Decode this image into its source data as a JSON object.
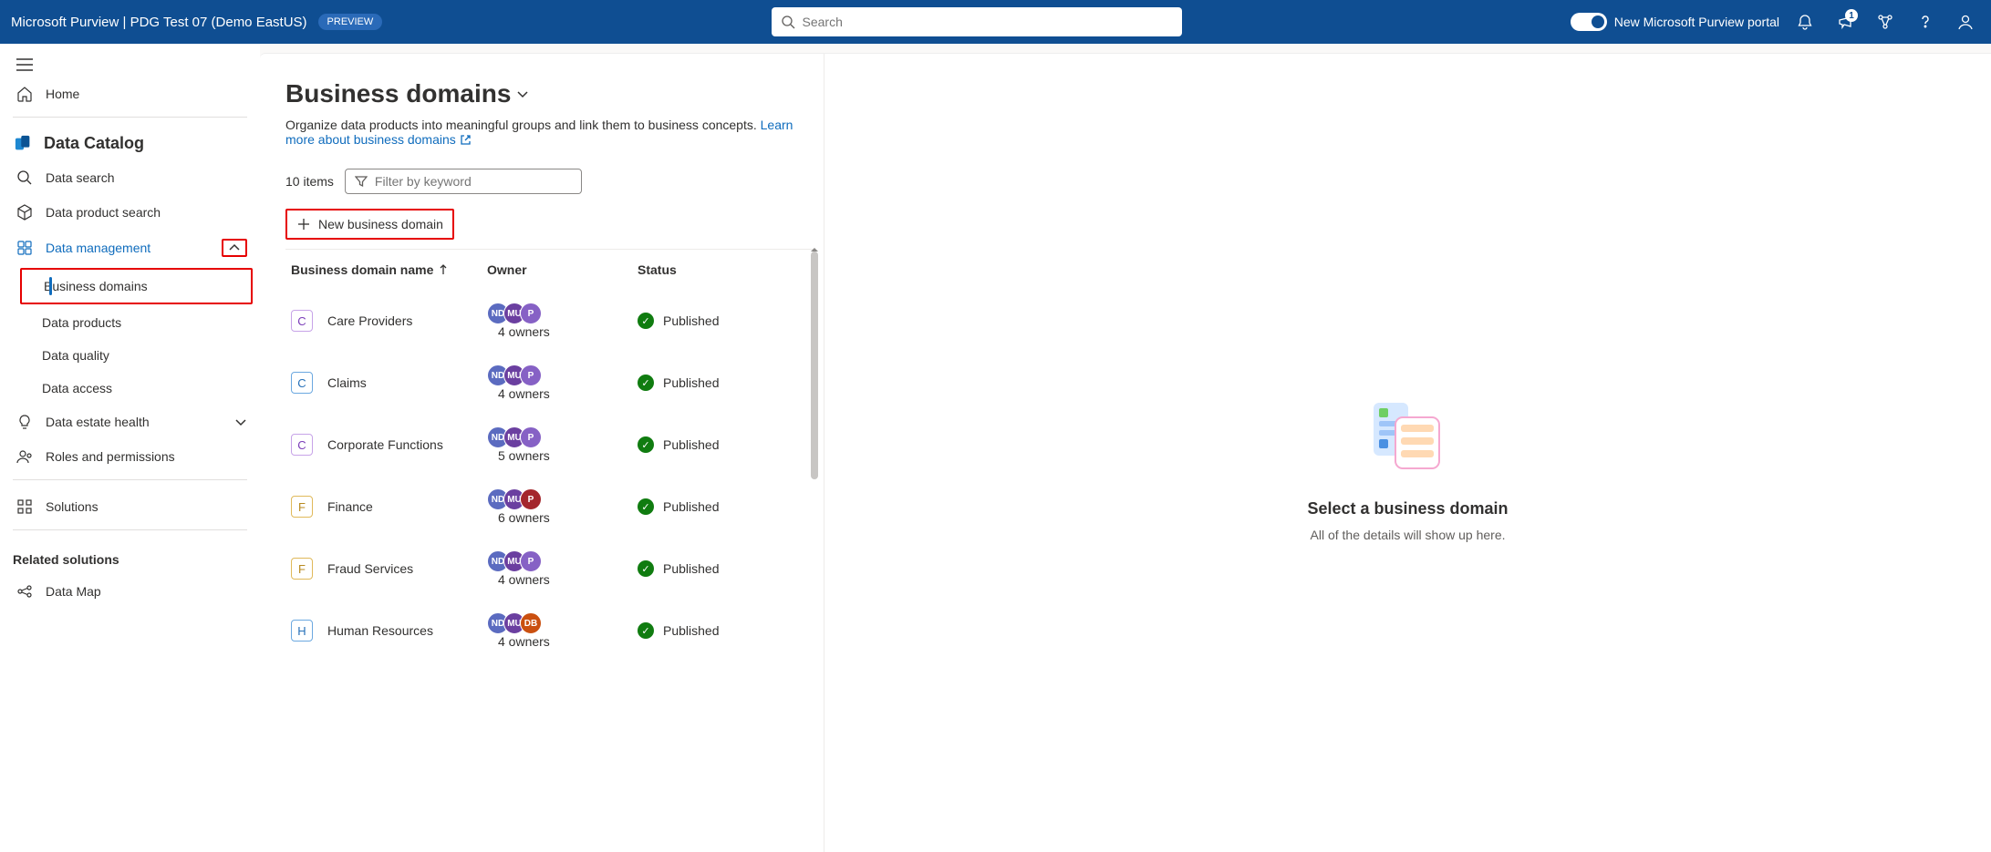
{
  "header": {
    "title": "Microsoft Purview | PDG Test 07 (Demo EastUS)",
    "preview": "PREVIEW",
    "search_placeholder": "Search",
    "toggle_label": "New Microsoft Purview portal",
    "notif_badge": "1"
  },
  "sidebar": {
    "home": "Home",
    "catalog_heading": "Data Catalog",
    "items": {
      "data_search": "Data search",
      "data_product_search": "Data product search",
      "data_management": "Data management",
      "business_domains": "Business domains",
      "data_products": "Data products",
      "data_quality": "Data quality",
      "data_access": "Data access",
      "data_estate_health": "Data estate health",
      "roles_permissions": "Roles and permissions",
      "solutions": "Solutions"
    },
    "related_title": "Related solutions",
    "data_map": "Data Map"
  },
  "page": {
    "title": "Business domains",
    "desc": "Organize data products into meaningful groups and link them to business concepts.",
    "learn_more": "Learn more about business domains",
    "item_count": "10 items",
    "filter_placeholder": "Filter by keyword",
    "new_button": "New business domain",
    "columns": {
      "name": "Business domain name",
      "owner": "Owner",
      "status": "Status"
    }
  },
  "domains": [
    {
      "letter": "C",
      "chip": "purple",
      "name": "Care Providers",
      "avatars": [
        {
          "t": "ND",
          "c": "#5b6bc0"
        },
        {
          "t": "MU",
          "c": "#6b3fa0"
        },
        {
          "t": "P",
          "c": "#8661c5"
        }
      ],
      "owners": "4 owners",
      "status": "Published"
    },
    {
      "letter": "C",
      "chip": "blue",
      "name": "Claims",
      "avatars": [
        {
          "t": "ND",
          "c": "#5b6bc0"
        },
        {
          "t": "MU",
          "c": "#6b3fa0"
        },
        {
          "t": "P",
          "c": "#8661c5"
        }
      ],
      "owners": "4 owners",
      "status": "Published"
    },
    {
      "letter": "C",
      "chip": "purple",
      "name": "Corporate Functions",
      "avatars": [
        {
          "t": "ND",
          "c": "#5b6bc0"
        },
        {
          "t": "MU",
          "c": "#6b3fa0"
        },
        {
          "t": "P",
          "c": "#8661c5"
        }
      ],
      "owners": "5 owners",
      "status": "Published"
    },
    {
      "letter": "F",
      "chip": "yellow",
      "name": "Finance",
      "avatars": [
        {
          "t": "ND",
          "c": "#5b6bc0"
        },
        {
          "t": "MU",
          "c": "#6b3fa0"
        },
        {
          "t": "P",
          "c": "#a4262c"
        }
      ],
      "owners": "6 owners",
      "status": "Published"
    },
    {
      "letter": "F",
      "chip": "yellow",
      "name": "Fraud Services",
      "avatars": [
        {
          "t": "ND",
          "c": "#5b6bc0"
        },
        {
          "t": "MU",
          "c": "#6b3fa0"
        },
        {
          "t": "P",
          "c": "#8661c5"
        }
      ],
      "owners": "4 owners",
      "status": "Published"
    },
    {
      "letter": "H",
      "chip": "blue",
      "name": "Human Resources",
      "avatars": [
        {
          "t": "ND",
          "c": "#5b6bc0"
        },
        {
          "t": "MU",
          "c": "#6b3fa0"
        },
        {
          "t": "DB",
          "c": "#ca5010"
        }
      ],
      "owners": "4 owners",
      "status": "Published"
    }
  ],
  "empty": {
    "title": "Select a business domain",
    "sub": "All of the details will show up here."
  }
}
